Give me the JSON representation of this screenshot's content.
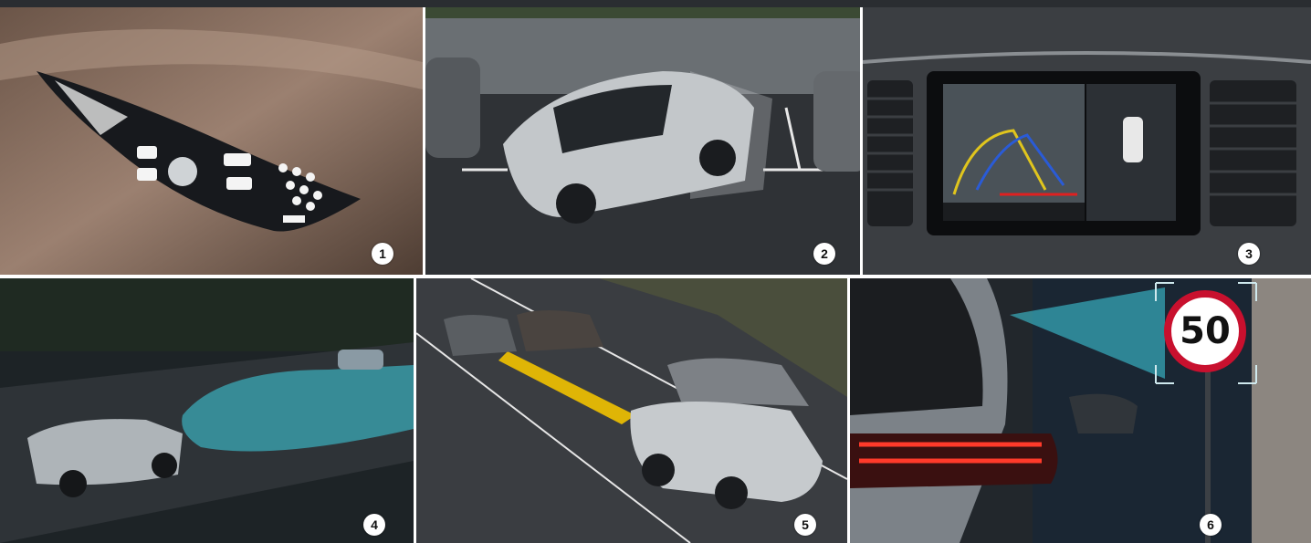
{
  "panels": [
    {
      "number": "1",
      "icon": "headlamp-icon"
    },
    {
      "number": "2",
      "icon": "parking-assist-icon"
    },
    {
      "number": "3",
      "icon": "rear-camera-icon"
    },
    {
      "number": "4",
      "icon": "high-beam-icon"
    },
    {
      "number": "5",
      "icon": "lane-keeping-icon"
    },
    {
      "number": "6",
      "icon": "speed-sign-recognition-icon"
    }
  ],
  "speed_sign": {
    "value": "50"
  },
  "colors": {
    "badge": "#ffffff",
    "divider": "#ffffff",
    "topbar": "#2a2d31",
    "sign_ring": "#c8102e",
    "beam": "#3fd3e6",
    "road_marking": "#f2c200"
  }
}
